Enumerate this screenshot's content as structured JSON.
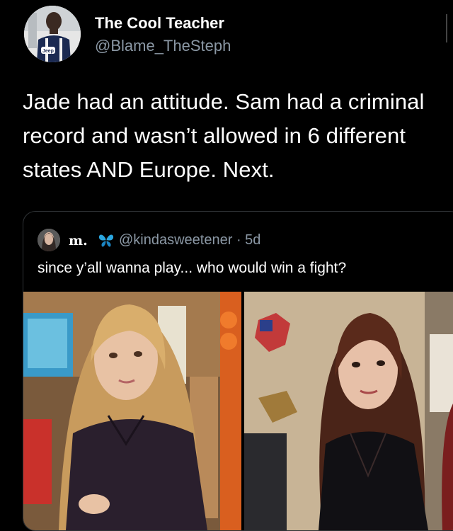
{
  "tweet": {
    "author_name": "The Cool Teacher",
    "author_handle": "@Blame_TheSteph",
    "text": "Jade had an attitude. Sam had a criminal record and wasn’t allowed in 6 different states AND Europe. Next."
  },
  "quote": {
    "author_name": "m.",
    "handle_and_time": "@kindasweetener · 5d",
    "text": "since y’all wanna play... who would win a fight?",
    "media": [
      {
        "icon": "photo-blonde-girl-kitchen"
      },
      {
        "icon": "photo-brunette-girl-room"
      }
    ]
  },
  "colors": {
    "background": "#000000",
    "text_primary": "#ffffff",
    "text_secondary": "#8b98a5",
    "border": "#2f3336"
  }
}
